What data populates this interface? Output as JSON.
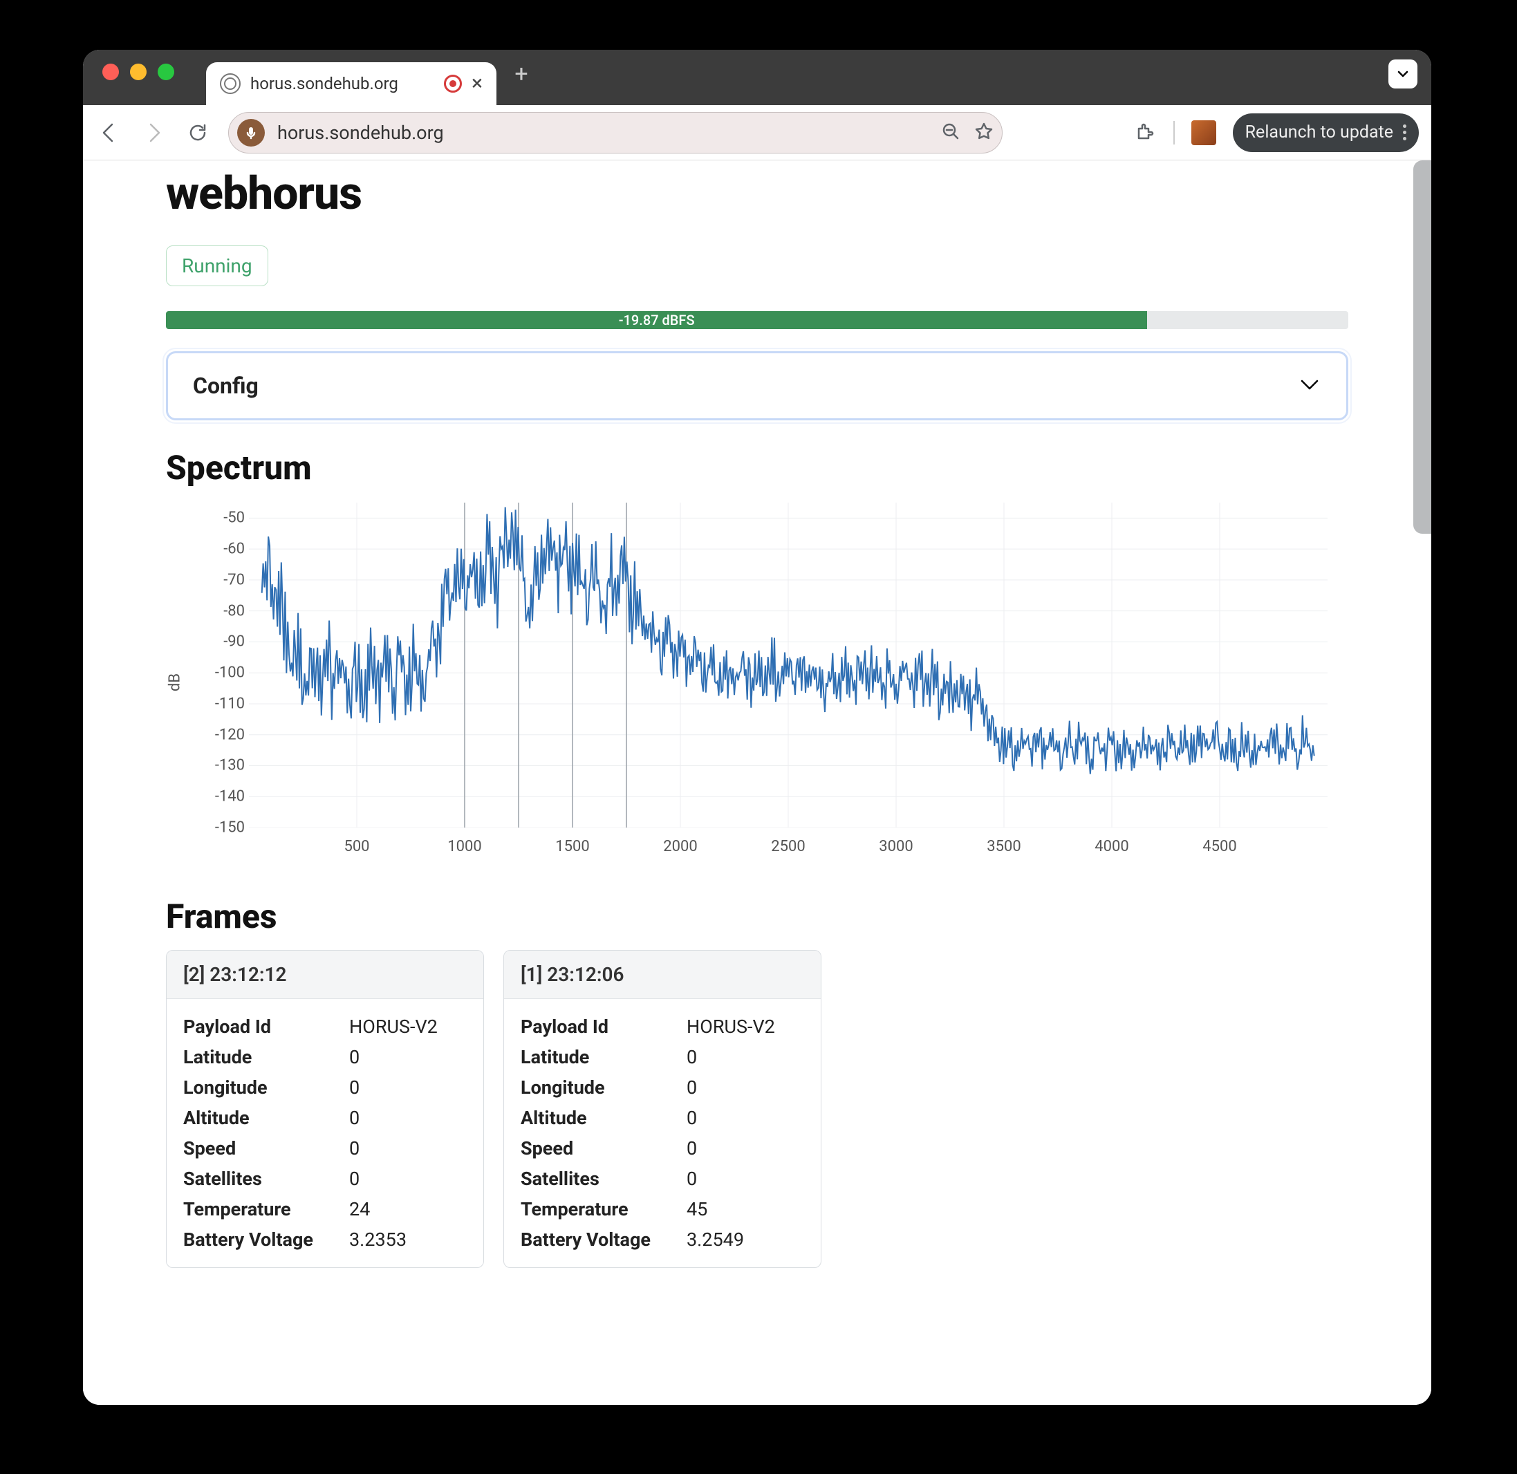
{
  "browser": {
    "tab_title": "horus.sondehub.org",
    "url": "horus.sondehub.org",
    "relaunch_label": "Relaunch to update"
  },
  "page": {
    "title": "webhorus",
    "status": "Running",
    "dbfs_label": "-19.87 dBFS",
    "dbfs_percent": 83,
    "config_label": "Config",
    "spectrum_heading": "Spectrum",
    "frames_heading": "Frames"
  },
  "chart_data": {
    "type": "line",
    "ylabel": "dB",
    "xlim": [
      0,
      5000
    ],
    "ylim": [
      -150,
      -45
    ],
    "xticks": [
      500,
      1000,
      1500,
      2000,
      2500,
      3000,
      3500,
      4000,
      4500
    ],
    "yticks": [
      -50,
      -60,
      -70,
      -80,
      -90,
      -100,
      -110,
      -120,
      -130,
      -140,
      -150
    ],
    "markers_x": [
      1000,
      1250,
      1500,
      1750
    ],
    "series": [
      {
        "name": "spectrum",
        "color": "#2f6fb3",
        "x": [
          80,
          120,
          180,
          250,
          350,
          450,
          550,
          650,
          750,
          850,
          900,
          950,
          1000,
          1050,
          1100,
          1150,
          1200,
          1230,
          1260,
          1300,
          1350,
          1400,
          1450,
          1500,
          1550,
          1600,
          1650,
          1700,
          1750,
          1800,
          1900,
          2000,
          2100,
          2200,
          2300,
          2400,
          2500,
          2700,
          2900,
          3100,
          3200,
          3300,
          3400,
          3450,
          3500,
          3600,
          3700,
          3800,
          3900,
          4000,
          4200,
          4400,
          4600,
          4800,
          4900
        ],
        "y": [
          -60,
          -65,
          -80,
          -92,
          -90,
          -92,
          -93,
          -92,
          -90,
          -85,
          -72,
          -62,
          -56,
          -62,
          -52,
          -60,
          -49,
          -46,
          -55,
          -68,
          -55,
          -50,
          -58,
          -52,
          -62,
          -55,
          -70,
          -60,
          -62,
          -75,
          -83,
          -88,
          -92,
          -94,
          -95,
          -93,
          -95,
          -95,
          -94,
          -96,
          -98,
          -100,
          -105,
          -115,
          -118,
          -118,
          -120,
          -118,
          -120,
          -119,
          -120,
          -118,
          -120,
          -119,
          -118
        ]
      }
    ]
  },
  "frames": [
    {
      "header": "[2] 23:12:12",
      "fields": [
        {
          "k": "Payload Id",
          "v": "HORUS-V2"
        },
        {
          "k": "Latitude",
          "v": "0"
        },
        {
          "k": "Longitude",
          "v": "0"
        },
        {
          "k": "Altitude",
          "v": "0"
        },
        {
          "k": "Speed",
          "v": "0"
        },
        {
          "k": "Satellites",
          "v": "0"
        },
        {
          "k": "Temperature",
          "v": "24"
        },
        {
          "k": "Battery Voltage",
          "v": "3.2353"
        }
      ]
    },
    {
      "header": "[1] 23:12:06",
      "fields": [
        {
          "k": "Payload Id",
          "v": "HORUS-V2"
        },
        {
          "k": "Latitude",
          "v": "0"
        },
        {
          "k": "Longitude",
          "v": "0"
        },
        {
          "k": "Altitude",
          "v": "0"
        },
        {
          "k": "Speed",
          "v": "0"
        },
        {
          "k": "Satellites",
          "v": "0"
        },
        {
          "k": "Temperature",
          "v": "45"
        },
        {
          "k": "Battery Voltage",
          "v": "3.2549"
        }
      ]
    }
  ]
}
